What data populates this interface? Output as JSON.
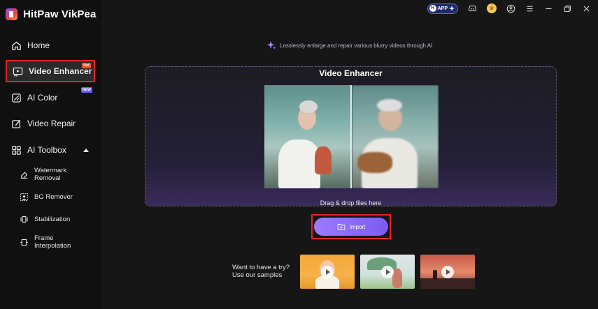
{
  "app": {
    "name": "HitPaw VikPea"
  },
  "topbar": {
    "app_label": "APP",
    "app_mark": "H"
  },
  "sidebar": {
    "items": [
      {
        "label": "Home",
        "badge": ""
      },
      {
        "label": "Video Enhancer",
        "badge": "Hot"
      },
      {
        "label": "AI Color",
        "badge": "NEW"
      },
      {
        "label": "Video Repair",
        "badge": ""
      },
      {
        "label": "AI Toolbox",
        "badge": ""
      }
    ],
    "toolbox": [
      {
        "label": "Watermark Removal"
      },
      {
        "label": "BG Remover"
      },
      {
        "label": "Stabilization"
      },
      {
        "label": "Frame Interpolation"
      }
    ]
  },
  "main": {
    "tagline": "Losslessly enlarge and repair various blurry videos through AI",
    "dropzone": {
      "title": "Video Enhancer",
      "hint": "Drag & drop files here"
    },
    "import_label": "Import",
    "samples": {
      "line1": "Want to have a try?",
      "line2": "Use our samples"
    }
  },
  "colors": {
    "accent": "#8b6cff",
    "highlight": "#e0252b",
    "hot": "#ff4b24",
    "new": "#6b5cff"
  }
}
